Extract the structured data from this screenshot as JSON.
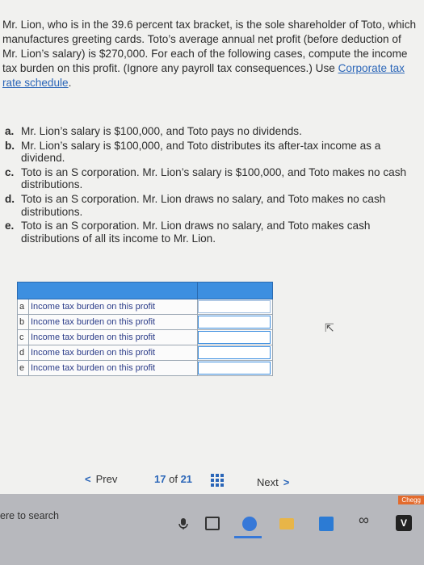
{
  "problem": {
    "intro": "Mr. Lion, who is in the 39.6 percent tax bracket, is the sole shareholder of Toto, which manufactures greeting cards. Toto’s average annual net profit (before deduction of Mr. Lion’s salary) is $270,000. For each of the following cases, compute the income tax burden on this profit. (Ignore any payroll tax consequences.) Use ",
    "link_label": "Corporate tax rate schedule",
    "link_suffix": ".",
    "cases": [
      {
        "letter": "a.",
        "text": "Mr. Lion’s salary is $100,000, and Toto pays no dividends."
      },
      {
        "letter": "b.",
        "text": "Mr. Lion’s salary is $100,000, and Toto distributes its after-tax income as a dividend."
      },
      {
        "letter": "c.",
        "text": "Toto is an S corporation. Mr. Lion’s salary is $100,000, and Toto makes no cash distributions."
      },
      {
        "letter": "d.",
        "text": "Toto is an S corporation. Mr. Lion draws no salary, and Toto makes no cash distributions."
      },
      {
        "letter": "e.",
        "text": "Toto is an S corporation. Mr. Lion draws no salary, and Toto makes cash distributions of all its income to Mr. Lion."
      }
    ]
  },
  "answer_table": {
    "rows": [
      {
        "label": "a",
        "desc": "Income tax burden on this profit",
        "value": ""
      },
      {
        "label": "b",
        "desc": "Income tax burden on this profit",
        "value": ""
      },
      {
        "label": "c",
        "desc": "Income tax burden on this profit",
        "value": ""
      },
      {
        "label": "d",
        "desc": "Income tax burden on this profit",
        "value": ""
      },
      {
        "label": "e",
        "desc": "Income tax burden on this profit",
        "value": ""
      }
    ]
  },
  "pager": {
    "prev_label": "Prev",
    "current": "17",
    "of_label": "of",
    "total": "21",
    "next_label": "Next"
  },
  "taskbar": {
    "search_text": "ere to search",
    "chegg_label": "Chegg"
  },
  "colors": {
    "accent": "#3d8fe0",
    "link": "#2b66b8",
    "taskbar": "#b7b8bd"
  }
}
